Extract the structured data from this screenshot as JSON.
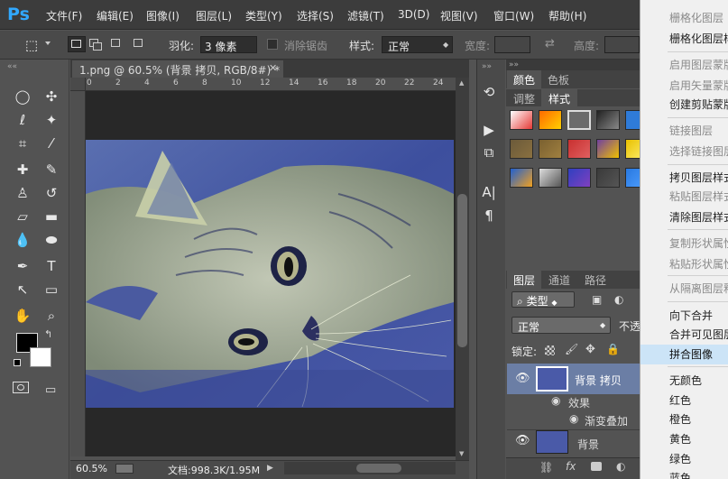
{
  "app": {
    "logo": "Ps"
  },
  "menu": [
    "文件(F)",
    "编辑(E)",
    "图像(I)",
    "图层(L)",
    "类型(Y)",
    "选择(S)",
    "滤镜(T)",
    "3D(D)",
    "视图(V)",
    "窗口(W)",
    "帮助(H)"
  ],
  "options": {
    "feather_label": "羽化:",
    "feather_value": "3 像素",
    "antialias_label": "消除锯齿",
    "style_label": "样式:",
    "style_value": "正常",
    "width_label": "宽度:",
    "height_label": "高度:"
  },
  "document": {
    "tab_title": "1.png @ 60.5% (背景 拷贝, RGB/8#) *",
    "zoom": "60.5%",
    "doc_info": "文档:998.3K/1.95M",
    "ruler_marks": [
      "0",
      "2",
      "4",
      "6",
      "8",
      "10",
      "12",
      "14",
      "16",
      "18",
      "20",
      "22",
      "24"
    ]
  },
  "panels": {
    "top_tabs": [
      "颜色",
      "色板"
    ],
    "second_tabs": [
      "调整",
      "样式"
    ],
    "layers_tabs": [
      "图层",
      "通道",
      "路径"
    ],
    "filter_kind": "类型",
    "blend_mode": "正常",
    "opacity_label": "不透",
    "lock_label": "锁定:",
    "layers": [
      {
        "name": "背景 拷贝",
        "selected": true
      },
      {
        "name": "效果",
        "sub": true
      },
      {
        "name": "渐变叠加",
        "sub": true
      },
      {
        "name": "背景",
        "selected": false
      }
    ]
  },
  "context_menu": {
    "items": [
      {
        "label": "栅格化图层",
        "disabled": true
      },
      {
        "label": "栅格化图层样式",
        "disabled": false
      },
      {
        "label": "启用图层蒙版",
        "disabled": true
      },
      {
        "label": "启用矢量蒙版",
        "disabled": true
      },
      {
        "label": "创建剪贴蒙版",
        "disabled": false
      },
      {
        "label": "链接图层",
        "disabled": true
      },
      {
        "label": "选择链接图层",
        "disabled": true
      },
      {
        "label": "拷贝图层样式",
        "disabled": false
      },
      {
        "label": "粘贴图层样式",
        "disabled": true
      },
      {
        "label": "清除图层样式",
        "disabled": false
      },
      {
        "label": "复制形状属性",
        "disabled": true
      },
      {
        "label": "粘贴形状属性",
        "disabled": true
      },
      {
        "label": "从隔离图层释放",
        "disabled": true
      },
      {
        "label": "向下合并",
        "disabled": false
      },
      {
        "label": "合并可见图层",
        "disabled": false
      },
      {
        "label": "拼合图像",
        "disabled": false,
        "highlighted": true
      },
      {
        "label": "无颜色",
        "disabled": false
      },
      {
        "label": "红色",
        "disabled": false
      },
      {
        "label": "橙色",
        "disabled": false
      },
      {
        "label": "黄色",
        "disabled": false
      },
      {
        "label": "绿色",
        "disabled": false
      },
      {
        "label": "蓝色",
        "disabled": false
      }
    ]
  },
  "colors": {
    "accent": "#31a8ff",
    "foreground": "#000000",
    "background": "#ffffff",
    "highlight": "#cce4f7"
  }
}
